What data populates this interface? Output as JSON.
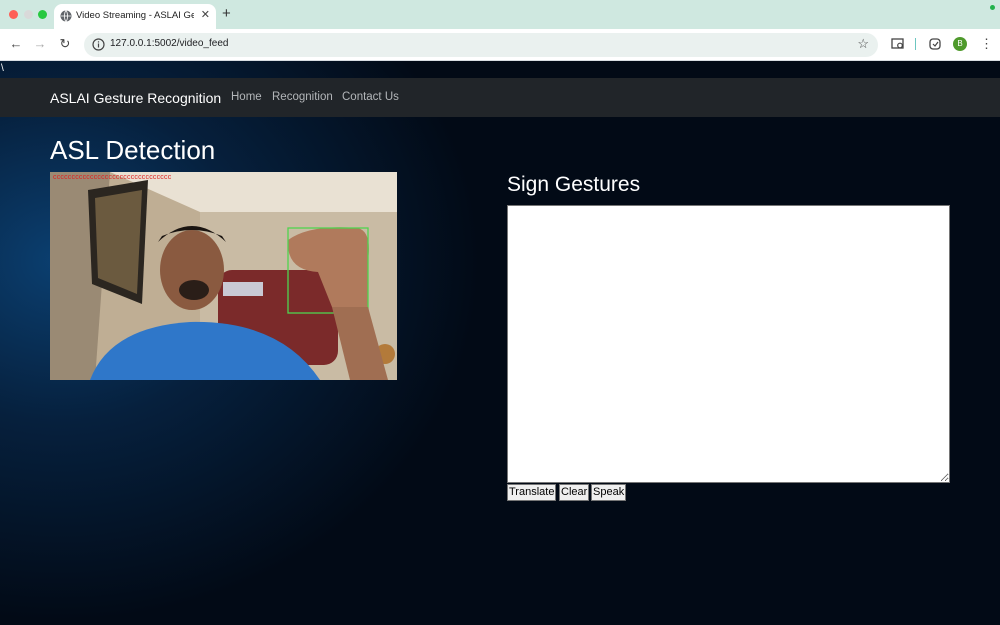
{
  "browser": {
    "tab_title": "Video Streaming - ASLAI Ges",
    "url": "127.0.0.1:5002/video_feed",
    "avatar_letter": "B"
  },
  "page": {
    "stray_text": "\\",
    "navbar": {
      "brand": "ASLAI Gesture Recognition",
      "links": [
        "Home",
        "Recognition",
        "Contact Us"
      ]
    },
    "heading": "ASL Detection",
    "video_overlay_text": "cccccccccccccccccccccccccccccccc",
    "sign_gestures": {
      "heading": "Sign Gestures",
      "text": ""
    },
    "buttons": {
      "translate": "Translate",
      "clear": "Clear",
      "speak": "Speak"
    }
  }
}
